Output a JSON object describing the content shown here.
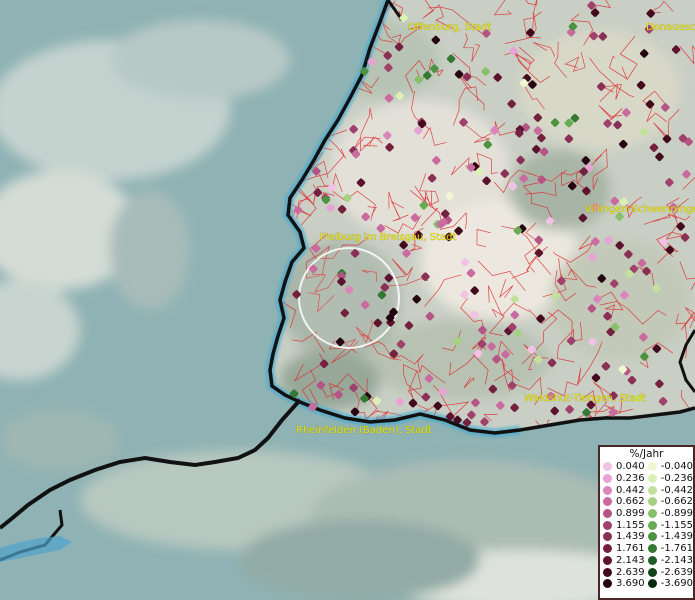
{
  "cities": [
    {
      "name": "Offenburg, Stadt"
    },
    {
      "name": "Donaueschingen"
    },
    {
      "name": "Freiburg im Breisgau, Stadt"
    },
    {
      "name": "Villingen-Schwenningen"
    },
    {
      "name": "Waldshut-Tiengen, Stadt"
    },
    {
      "name": "Rheinfelden (Baden), Stadt"
    }
  ],
  "legend": {
    "title": "%/Jahr",
    "positive": [
      {
        "label": "0.040",
        "color": "#f2c2e6"
      },
      {
        "label": "0.236",
        "color": "#e7a3d3"
      },
      {
        "label": "0.442",
        "color": "#da86bd"
      },
      {
        "label": "0.662",
        "color": "#c96b9f"
      },
      {
        "label": "0.899",
        "color": "#b55585"
      },
      {
        "label": "1.155",
        "color": "#a0416c"
      },
      {
        "label": "1.439",
        "color": "#8a2f55"
      },
      {
        "label": "1.761",
        "color": "#742140"
      },
      {
        "label": "2.143",
        "color": "#5c132e"
      },
      {
        "label": "2.639",
        "color": "#430a1e"
      },
      {
        "label": "3.690",
        "color": "#260310"
      }
    ],
    "negative": [
      {
        "label": "-0.040",
        "color": "#f0f7d0"
      },
      {
        "label": "-0.236",
        "color": "#dcefb4"
      },
      {
        "label": "-0.442",
        "color": "#c2e29b"
      },
      {
        "label": "-0.662",
        "color": "#a5d282"
      },
      {
        "label": "-0.899",
        "color": "#86c06a"
      },
      {
        "label": "-1.155",
        "color": "#67ab52"
      },
      {
        "label": "-1.439",
        "color": "#4b9341"
      },
      {
        "label": "-1.761",
        "color": "#337933"
      },
      {
        "label": "-2.143",
        "color": "#1f5e26"
      },
      {
        "label": "-2.639",
        "color": "#114419"
      },
      {
        "label": "-3.690",
        "color": "#062a0d"
      }
    ]
  },
  "colors": {
    "water": "#8fb2b4",
    "land": "#c9cfc4",
    "border_line": "#111111",
    "river_glow": "#3aa9d6",
    "municipal_lines": "#e0262a",
    "label_text": "#e8e400",
    "legend_border": "#4a2626"
  }
}
